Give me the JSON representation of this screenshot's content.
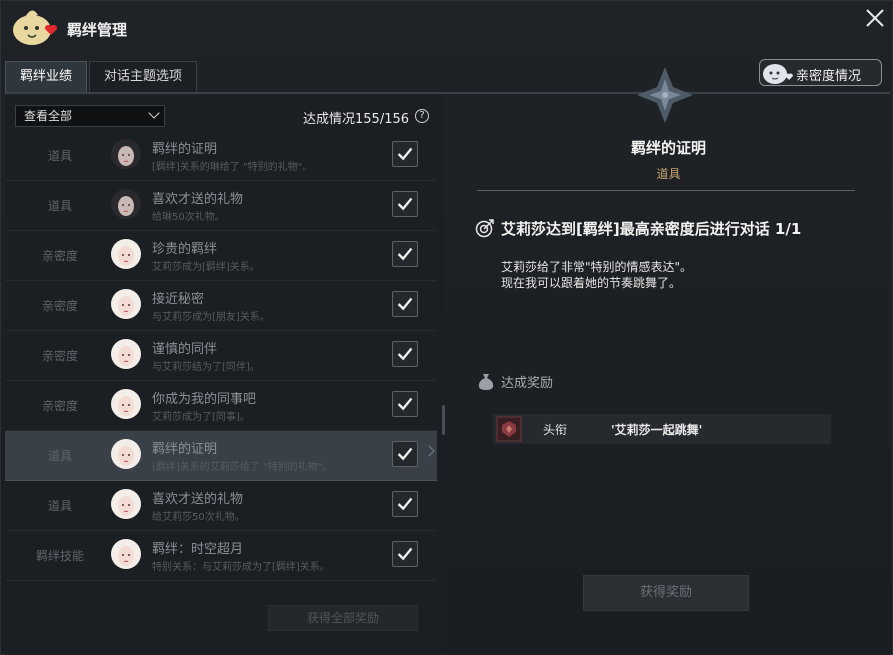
{
  "window": {
    "title": "羁绊管理"
  },
  "tabs": [
    {
      "label": "羁绊业绩",
      "active": true
    },
    {
      "label": "对话主题选项",
      "active": false
    }
  ],
  "affection_button": {
    "label": "亲密度情况"
  },
  "left": {
    "filter": {
      "selected": "查看全部"
    },
    "progress_label": "达成情况155/156",
    "help": "?",
    "claim_all_label": "获得全部奖励",
    "rows": [
      {
        "category": "道具",
        "name": "羁绊的证明",
        "desc": "[羁绊]关系的琳给了 \"特别的礼物\"。",
        "checked": true,
        "selected": false,
        "avatar": "dark"
      },
      {
        "category": "道具",
        "name": "喜欢才送的礼物",
        "desc": "给琳50次礼物。",
        "checked": true,
        "selected": false,
        "avatar": "dark"
      },
      {
        "category": "亲密度",
        "name": "珍贵的羁绊",
        "desc": "艾莉莎成为[羁绊]关系。",
        "checked": true,
        "selected": false,
        "avatar": "light"
      },
      {
        "category": "亲密度",
        "name": "接近秘密",
        "desc": "与艾莉莎成为[朋友]关系。",
        "checked": true,
        "selected": false,
        "avatar": "light"
      },
      {
        "category": "亲密度",
        "name": "谨慎的同伴",
        "desc": "与艾莉莎结为了[同伴]。",
        "checked": true,
        "selected": false,
        "avatar": "light"
      },
      {
        "category": "亲密度",
        "name": "你成为我的同事吧",
        "desc": "艾莉莎成为了[同事]。",
        "checked": true,
        "selected": false,
        "avatar": "light"
      },
      {
        "category": "道具",
        "name": "羁绊的证明",
        "desc": "[羁绊]关系的艾莉莎给了 \"特别的礼物\"。",
        "checked": true,
        "selected": true,
        "avatar": "light"
      },
      {
        "category": "道具",
        "name": "喜欢才送的礼物",
        "desc": "给艾莉莎50次礼物。",
        "checked": true,
        "selected": false,
        "avatar": "light"
      },
      {
        "category": "羁绊技能",
        "name": "羁绊：时空超月",
        "desc": "特别关系：与艾莉莎成为了[羁绊]关系。",
        "checked": true,
        "selected": false,
        "avatar": "light"
      }
    ]
  },
  "detail": {
    "title": "羁绊的证明",
    "subtitle": "道具",
    "task": "艾莉莎达到[羁绊]最高亲密度后进行对话 1/1",
    "desc_lines": [
      "艾莉莎给了非常\"特别的情感表达\"。",
      "现在我可以跟着她的节奏跳舞了。"
    ],
    "reward_title": "达成奖励",
    "reward": {
      "type": "头衔",
      "value": "'艾莉莎一起跳舞'"
    },
    "claim_label": "获得奖励"
  },
  "colors": {
    "accent_gold": "#c9a66b",
    "selected_row": "#394048"
  }
}
